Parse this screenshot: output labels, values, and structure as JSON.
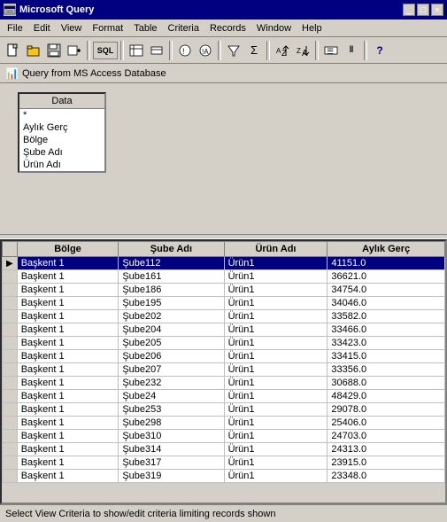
{
  "titleBar": {
    "title": "Microsoft Query",
    "icon": "🔷"
  },
  "menuBar": {
    "items": [
      "File",
      "Edit",
      "View",
      "Format",
      "Table",
      "Criteria",
      "Records",
      "Window",
      "Help"
    ]
  },
  "toolbar": {
    "buttons": [
      {
        "name": "new",
        "icon": "📄"
      },
      {
        "name": "open",
        "icon": "📂"
      },
      {
        "name": "save",
        "icon": "💾"
      },
      {
        "name": "add-table",
        "icon": "+"
      },
      {
        "name": "sql",
        "icon": "SQL"
      },
      {
        "name": "field-list",
        "icon": "≡"
      },
      {
        "name": "table-names",
        "icon": "T"
      },
      {
        "name": "query-now",
        "icon": "!"
      },
      {
        "name": "filter",
        "icon": "▽"
      },
      {
        "name": "sigma",
        "icon": "Σ"
      },
      {
        "name": "sort-asc",
        "icon": "↑A"
      },
      {
        "name": "sort-desc",
        "icon": "↓Z"
      },
      {
        "name": "criteria-field",
        "icon": "☰"
      },
      {
        "name": "or-criteria",
        "icon": "||"
      },
      {
        "name": "help",
        "icon": "?"
      }
    ]
  },
  "queryTitle": "Query from MS Access Database",
  "dataPanel": {
    "header": "Data",
    "fields": [
      "*",
      "Aylık Gerç",
      "Bölge",
      "Şube Adı",
      "Ürün Adı"
    ]
  },
  "grid": {
    "columns": [
      "Bölge",
      "Şube Adı",
      "Ürün Adı",
      "Aylık Gerç"
    ],
    "rows": [
      {
        "bolge": "Başkent 1",
        "sube": "Şube112",
        "urun": "Ürün1",
        "aylik": "41151.0",
        "selected": true
      },
      {
        "bolge": "Başkent 1",
        "sube": "Şube161",
        "urun": "Ürün1",
        "aylik": "36621.0",
        "selected": false
      },
      {
        "bolge": "Başkent 1",
        "sube": "Şube186",
        "urun": "Ürün1",
        "aylik": "34754.0",
        "selected": false
      },
      {
        "bolge": "Başkent 1",
        "sube": "Şube195",
        "urun": "Ürün1",
        "aylik": "34046.0",
        "selected": false
      },
      {
        "bolge": "Başkent 1",
        "sube": "Şube202",
        "urun": "Ürün1",
        "aylik": "33582.0",
        "selected": false
      },
      {
        "bolge": "Başkent 1",
        "sube": "Şube204",
        "urun": "Ürün1",
        "aylik": "33466.0",
        "selected": false
      },
      {
        "bolge": "Başkent 1",
        "sube": "Şube205",
        "urun": "Ürün1",
        "aylik": "33423.0",
        "selected": false
      },
      {
        "bolge": "Başkent 1",
        "sube": "Şube206",
        "urun": "Ürün1",
        "aylik": "33415.0",
        "selected": false
      },
      {
        "bolge": "Başkent 1",
        "sube": "Şube207",
        "urun": "Ürün1",
        "aylik": "33356.0",
        "selected": false
      },
      {
        "bolge": "Başkent 1",
        "sube": "Şube232",
        "urun": "Ürün1",
        "aylik": "30688.0",
        "selected": false
      },
      {
        "bolge": "Başkent 1",
        "sube": "Şube24",
        "urun": "Ürün1",
        "aylik": "48429.0",
        "selected": false
      },
      {
        "bolge": "Başkent 1",
        "sube": "Şube253",
        "urun": "Ürün1",
        "aylik": "29078.0",
        "selected": false
      },
      {
        "bolge": "Başkent 1",
        "sube": "Şube298",
        "urun": "Ürün1",
        "aylik": "25406.0",
        "selected": false
      },
      {
        "bolge": "Başkent 1",
        "sube": "Şube310",
        "urun": "Ürün1",
        "aylik": "24703.0",
        "selected": false
      },
      {
        "bolge": "Başkent 1",
        "sube": "Şube314",
        "urun": "Ürün1",
        "aylik": "24313.0",
        "selected": false
      },
      {
        "bolge": "Başkent 1",
        "sube": "Şube317",
        "urun": "Ürün1",
        "aylik": "23915.0",
        "selected": false
      },
      {
        "bolge": "Başkent 1",
        "sube": "Şube319",
        "urun": "Ürün1",
        "aylik": "23348.0",
        "selected": false
      }
    ]
  },
  "statusBar": {
    "text": "Select View Criteria to show/edit criteria limiting records shown"
  }
}
